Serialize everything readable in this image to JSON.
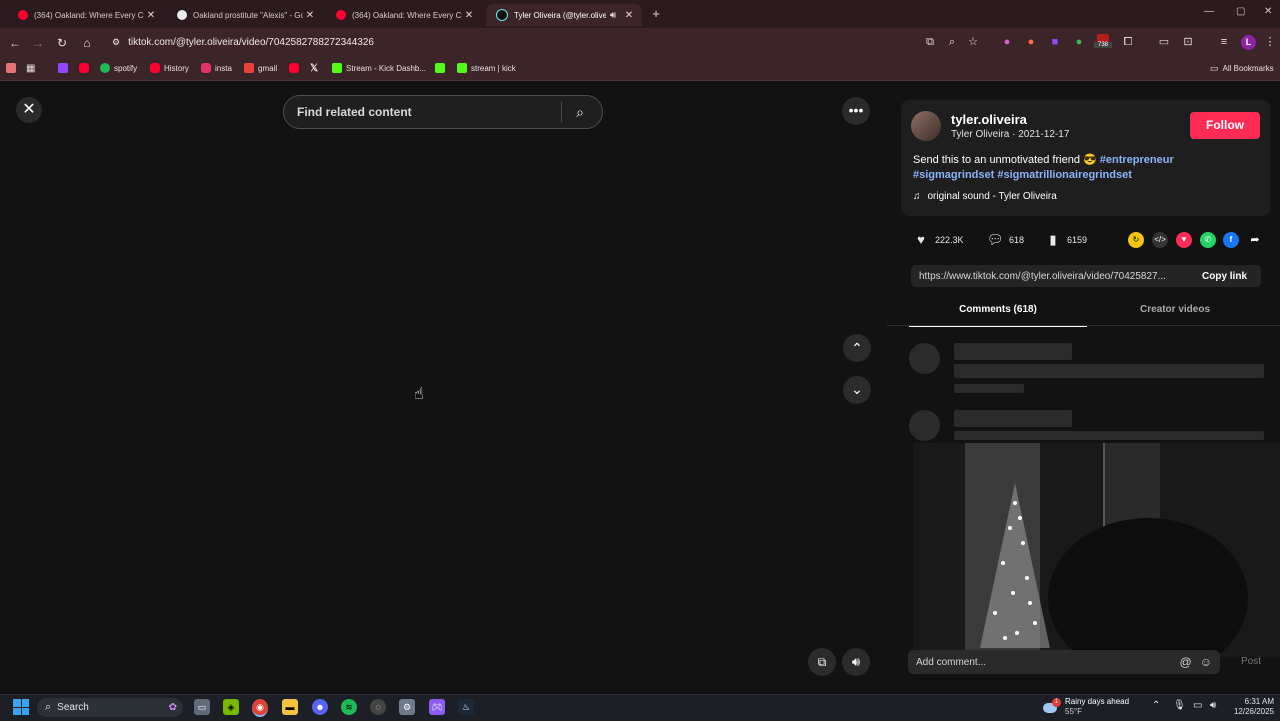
{
  "browser": {
    "tabs": [
      {
        "title": "(364) Oakland: Where Every Cr",
        "favicon_color": "#ff0033"
      },
      {
        "title": "Oakland prostitute \"Alexis\" - Go",
        "favicon_color": "#e8eaed"
      },
      {
        "title": "(364) Oakland: Where Every Cr",
        "favicon_color": "#ff0033"
      },
      {
        "title": "Tyler Oliveira (@tyler.olivei",
        "favicon_color": "#111111"
      }
    ],
    "url": "tiktok.com/@tyler.oliveira/video/7042582788272344326",
    "bookmarks": [
      {
        "label": "",
        "color": "#9146ff"
      },
      {
        "label": "",
        "color": "#ff0033"
      },
      {
        "label": "spotify",
        "color": "#1db954"
      },
      {
        "label": "History",
        "color": "#ff0033"
      },
      {
        "label": "insta",
        "color": "#e1306c"
      },
      {
        "label": "gmail",
        "color": "#ea4335"
      },
      {
        "label": "",
        "color": "#ff0033"
      },
      {
        "label": "",
        "color": "#ffffff"
      },
      {
        "label": "Stream - Kick Dashb...",
        "color": "#53fc18"
      },
      {
        "label": "",
        "color": "#53fc18"
      },
      {
        "label": "stream | kick",
        "color": "#53fc18"
      }
    ],
    "all_bookmarks": "All Bookmarks",
    "badge_count": "738"
  },
  "video_view": {
    "search_placeholder": "Find related content"
  },
  "post": {
    "username": "tyler.oliveira",
    "display_line": "Tyler Oliveira · 2021-12-17",
    "follow_label": "Follow",
    "caption_text": "Send this to an unmotivated friend 😎",
    "hashtags": [
      "#entrepreneur",
      "#sigmagrindset",
      "#sigmatrillionairegrindset"
    ],
    "sound": "original sound - Tyler Oliveira",
    "likes": "222.3K",
    "comments": "618",
    "saves": "6159",
    "link": "https://www.tiktok.com/@tyler.oliveira/video/70425827...",
    "copy_link_label": "Copy link",
    "tab_comments": "Comments (618)",
    "tab_creator": "Creator videos",
    "add_comment_placeholder": "Add comment...",
    "post_label": "Post"
  },
  "taskbar": {
    "search_label": "Search",
    "weather_line1": "Rainy days ahead",
    "weather_line2": "55°F",
    "notification_count": "1",
    "time": "6:31 AM",
    "date": "12/26/2025"
  }
}
